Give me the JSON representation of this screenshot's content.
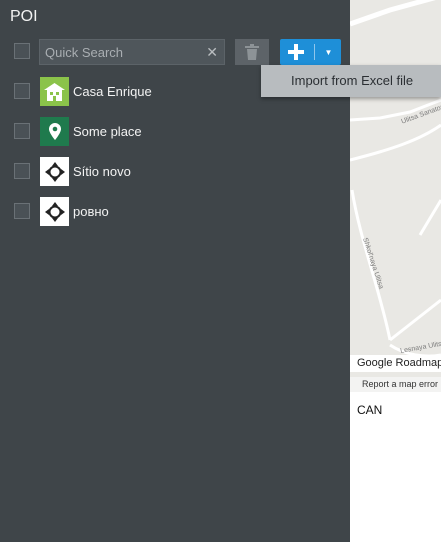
{
  "panel": {
    "title": "POI",
    "search": {
      "placeholder": "Quick Search",
      "value": ""
    },
    "add_menu": {
      "items": [
        "Import from Excel file"
      ]
    },
    "poi_items": [
      {
        "name": "Casa Enrique",
        "icon": "house-icon",
        "icon_bg": "#8bc34a"
      },
      {
        "name": "Some place",
        "icon": "map-pin-icon",
        "icon_bg": "#1f7a4d"
      },
      {
        "name": "Sítio novo",
        "icon": "crosshair-icon",
        "icon_bg": "#ffffff"
      },
      {
        "name": "ровно",
        "icon": "crosshair-icon",
        "icon_bg": "#ffffff"
      }
    ]
  },
  "map": {
    "street_labels": [
      "Ulitsa Sanatorna",
      "Shkol'naya Ulitsa",
      "Lesnaya Ulitsa"
    ],
    "map_type": "Google Roadmap",
    "report_link": "Report a map error"
  },
  "below_map_text": "CAN",
  "colors": {
    "panel_bg": "#3f4549",
    "accent": "#1e8fd8",
    "menu_bg": "#b8bcbf"
  }
}
